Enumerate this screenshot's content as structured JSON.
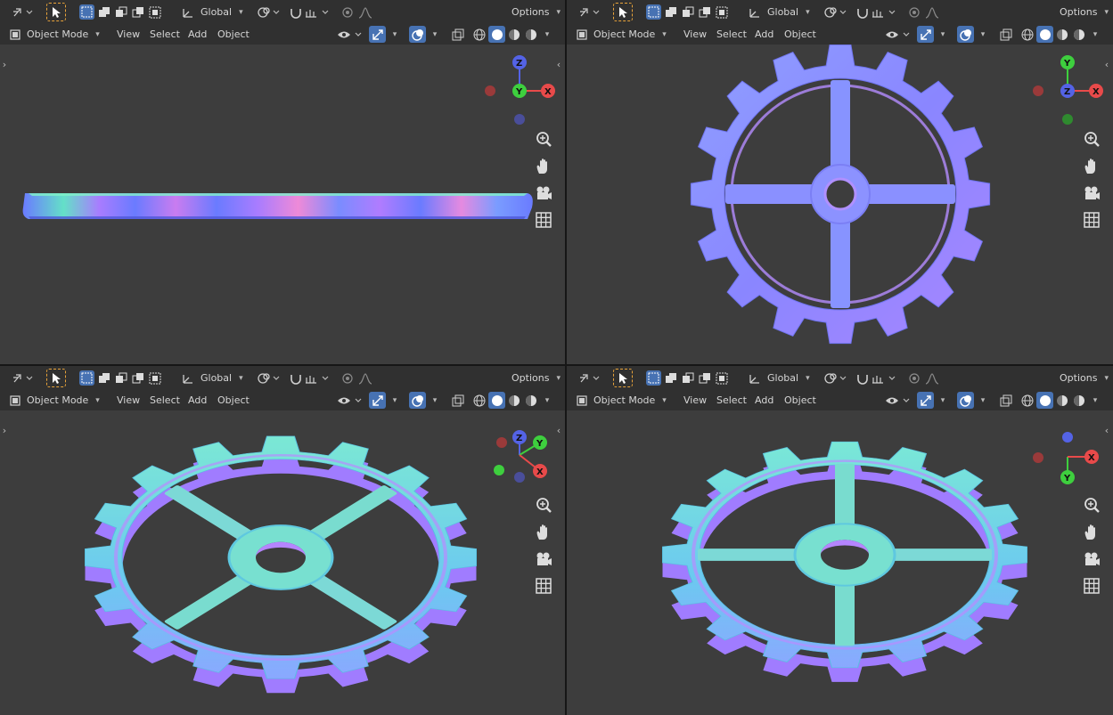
{
  "header": {
    "transform_orientation": "Global",
    "options_label": "Options",
    "mode_label": "Object Mode",
    "menu": [
      "View",
      "Select",
      "Add",
      "Object"
    ]
  },
  "viewports": [
    {
      "name": "front-view",
      "view": "front",
      "gizmo_axes": [
        "Z",
        "Y",
        "X"
      ]
    },
    {
      "name": "top-view",
      "view": "top",
      "gizmo_axes": [
        "Y",
        "Z",
        "X"
      ]
    },
    {
      "name": "user-perspective-view",
      "view": "perspective",
      "gizmo_axes": [
        "Z",
        "Y",
        "X"
      ]
    },
    {
      "name": "right-perspective-view",
      "view": "perspective",
      "gizmo_axes": [
        "X",
        "Y"
      ]
    }
  ],
  "icons": {
    "select_tool": "cursor-arrow-icon",
    "box_select": "box-select-icon",
    "zoom": "zoom-in-icon",
    "pan": "hand-icon",
    "camera": "camera-icon",
    "grid": "grid-icon"
  },
  "colors": {
    "axis_x": "#e84a4a",
    "axis_y": "#3ecf3e",
    "axis_z": "#5463e6",
    "active_blue": "#4772b3",
    "viewport_bg": "#3d3d3d",
    "header_bg": "#303030"
  }
}
